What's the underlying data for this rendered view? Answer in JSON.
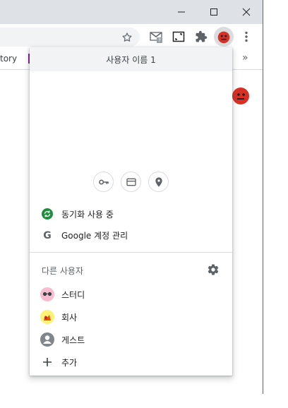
{
  "window": {
    "minimize_glyph": "—",
    "maximize_glyph": "☐",
    "close_glyph": "✕"
  },
  "bookmarks": {
    "partial_item": "tory",
    "overflow_glyph": "»"
  },
  "profile_menu": {
    "header_title": "사용자 이름 1",
    "quick_actions": [
      "key-icon",
      "credit-card-icon",
      "location-pin-icon"
    ],
    "sync_label": "동기화 사용 중",
    "manage_account_label": "Google 계정 관리",
    "other_users_label": "다른 사용자",
    "profiles": [
      {
        "name": "스터디",
        "avatar": "sunglasses-avatar"
      },
      {
        "name": "회사",
        "avatar": "cat-avatar"
      },
      {
        "name": "게스트",
        "avatar": "guest-avatar"
      }
    ],
    "add_label": "추가"
  },
  "colors": {
    "sync_green": "#1e8e3e",
    "avatar_red": "#d93025"
  }
}
